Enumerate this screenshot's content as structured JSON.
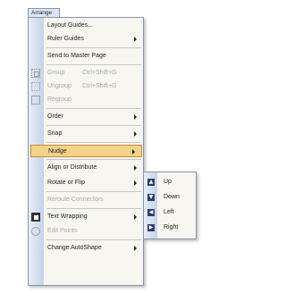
{
  "menubar": {
    "label": "Arrange"
  },
  "menu": {
    "items": [
      {
        "label": "Layout Guides...",
        "disabled": false,
        "submenu": false
      },
      {
        "label": "Ruler Guides",
        "disabled": false,
        "submenu": true
      },
      {
        "label": "Send to Master Page",
        "disabled": false,
        "submenu": false
      },
      {
        "label": "Group",
        "shortcut": "Ctrl+Shift+G",
        "disabled": true,
        "icon": "group-icon"
      },
      {
        "label": "Ungroup",
        "shortcut": "Ctrl+Shift+G",
        "disabled": true,
        "icon": "ungroup-icon"
      },
      {
        "label": "Regroup",
        "disabled": true,
        "icon": "regroup-icon"
      },
      {
        "label": "Order",
        "disabled": false,
        "submenu": true
      },
      {
        "label": "Snap",
        "disabled": false,
        "submenu": true
      },
      {
        "label": "Nudge",
        "disabled": false,
        "submenu": true,
        "highlighted": true
      },
      {
        "label": "Align or Distribute",
        "disabled": false,
        "submenu": true
      },
      {
        "label": "Rotate or Flip",
        "disabled": false,
        "submenu": true
      },
      {
        "label": "Reroute Connectors",
        "disabled": true
      },
      {
        "label": "Text Wrapping",
        "disabled": false,
        "submenu": true,
        "icon": "text-wrapping-icon"
      },
      {
        "label": "Edit Points",
        "disabled": true,
        "icon": "edit-points-icon"
      },
      {
        "label": "Change AutoShape",
        "disabled": false,
        "submenu": true
      }
    ]
  },
  "nudge_submenu": {
    "items": [
      {
        "label": "Up",
        "glyph": "▲"
      },
      {
        "label": "Down",
        "glyph": "▼"
      },
      {
        "label": "Left",
        "glyph": "◀"
      },
      {
        "label": "Right",
        "glyph": "▶"
      }
    ]
  },
  "colors": {
    "highlight": "#f5d28a",
    "highlight_border": "#c78a3c",
    "menu_background": "#f7f6f1",
    "gutter": "#c5d3e8"
  }
}
